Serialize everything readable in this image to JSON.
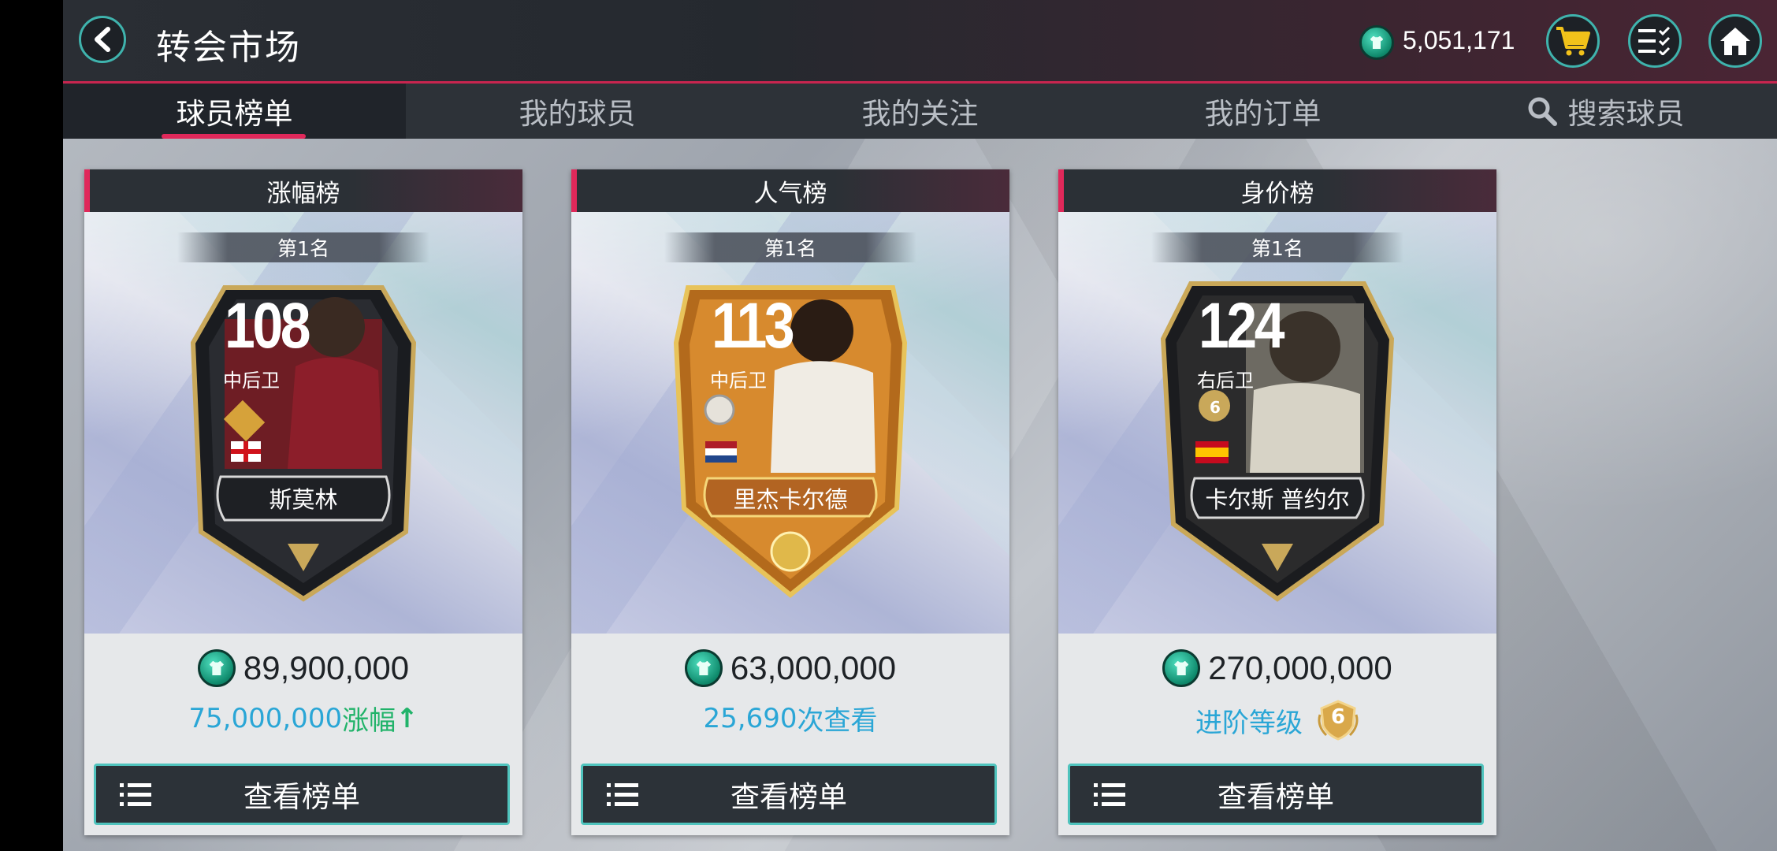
{
  "header": {
    "title": "转会市场",
    "balance": "5,051,171"
  },
  "tabs": [
    {
      "label": "球员榜单",
      "active": true
    },
    {
      "label": "我的球员",
      "active": false
    },
    {
      "label": "我的关注",
      "active": false
    },
    {
      "label": "我的订单",
      "active": false
    },
    {
      "label": "搜索球员",
      "active": false
    }
  ],
  "cards": [
    {
      "title": "涨幅榜",
      "rank": "第1名",
      "player": {
        "rating": "108",
        "position": "中后卫",
        "name": "斯莫林",
        "flag": "england"
      },
      "price": "89,900,000",
      "sub_value": "75,000,000",
      "sub_suffix": "涨幅",
      "sub_arrow": "↑",
      "button_label": "查看榜单"
    },
    {
      "title": "人气榜",
      "rank": "第1名",
      "player": {
        "rating": "113",
        "position": "中后卫",
        "name": "里杰卡尔德",
        "flag": "netherlands"
      },
      "price": "63,000,000",
      "sub_value": "25,690",
      "sub_suffix": "次查看",
      "button_label": "查看榜单"
    },
    {
      "title": "身价榜",
      "rank": "第1名",
      "player": {
        "rating": "124",
        "position": "右后卫",
        "name": "卡尔斯 普约尔",
        "flag": "spain",
        "rank_badge": "6"
      },
      "price": "270,000,000",
      "sub_label": "进阶等级",
      "sub_badge": "6",
      "button_label": "查看榜单"
    }
  ],
  "colors": {
    "accent": "#e0285a",
    "teal": "#4fc3bd",
    "blue_text": "#2aa6d6",
    "green_text": "#21b36a",
    "coin": "#16a683"
  },
  "icons": [
    "back-arrow-icon",
    "coin-icon",
    "shopping-cart-icon",
    "checklist-menu-icon",
    "home-icon",
    "search-icon",
    "list-icon"
  ]
}
